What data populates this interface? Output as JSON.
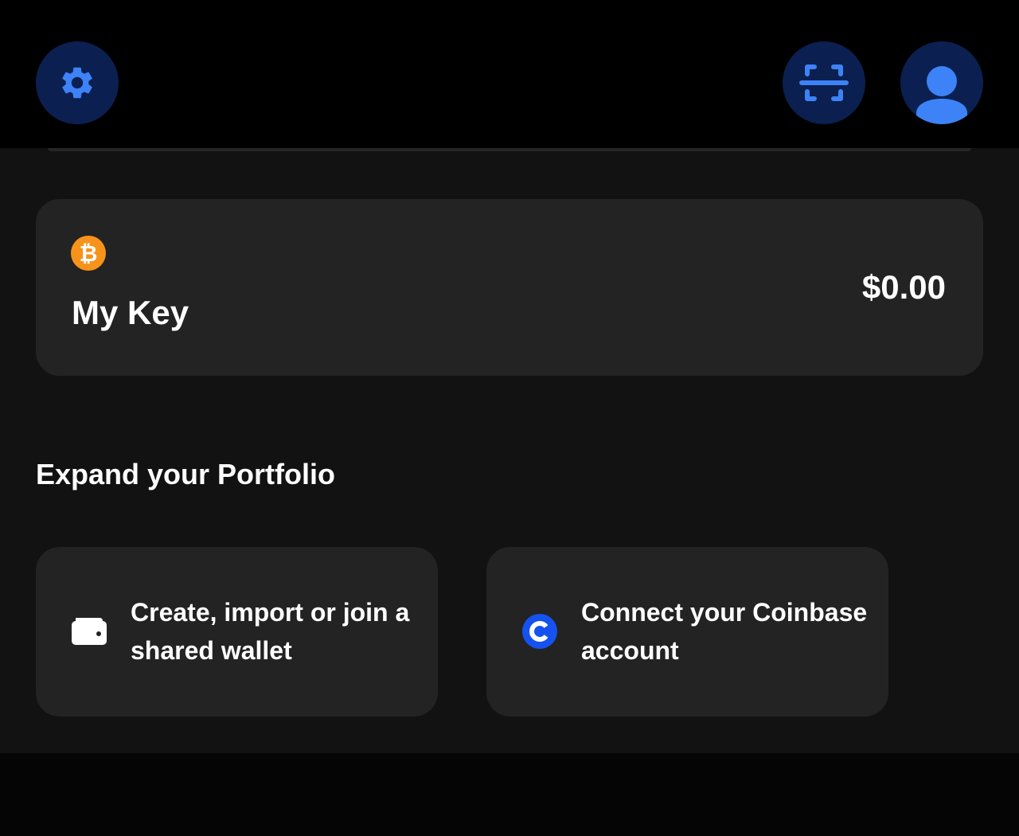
{
  "header": {
    "settings_icon": "gear-icon",
    "scan_icon": "scan-icon",
    "profile_icon": "user-icon",
    "accent_color": "#3d82f6",
    "button_bg": "#0b2050"
  },
  "wallet": {
    "coin_icon": "bitcoin-icon",
    "coin_symbol": "₿",
    "coin_color": "#f7931a",
    "name": "My Key",
    "balance": "$0.00"
  },
  "portfolio": {
    "title": "Expand your Portfolio",
    "actions": [
      {
        "icon": "wallet-icon",
        "label": "Create, import or join a shared wallet"
      },
      {
        "icon": "coinbase-icon",
        "label": "Connect your Coinbase account"
      }
    ]
  }
}
